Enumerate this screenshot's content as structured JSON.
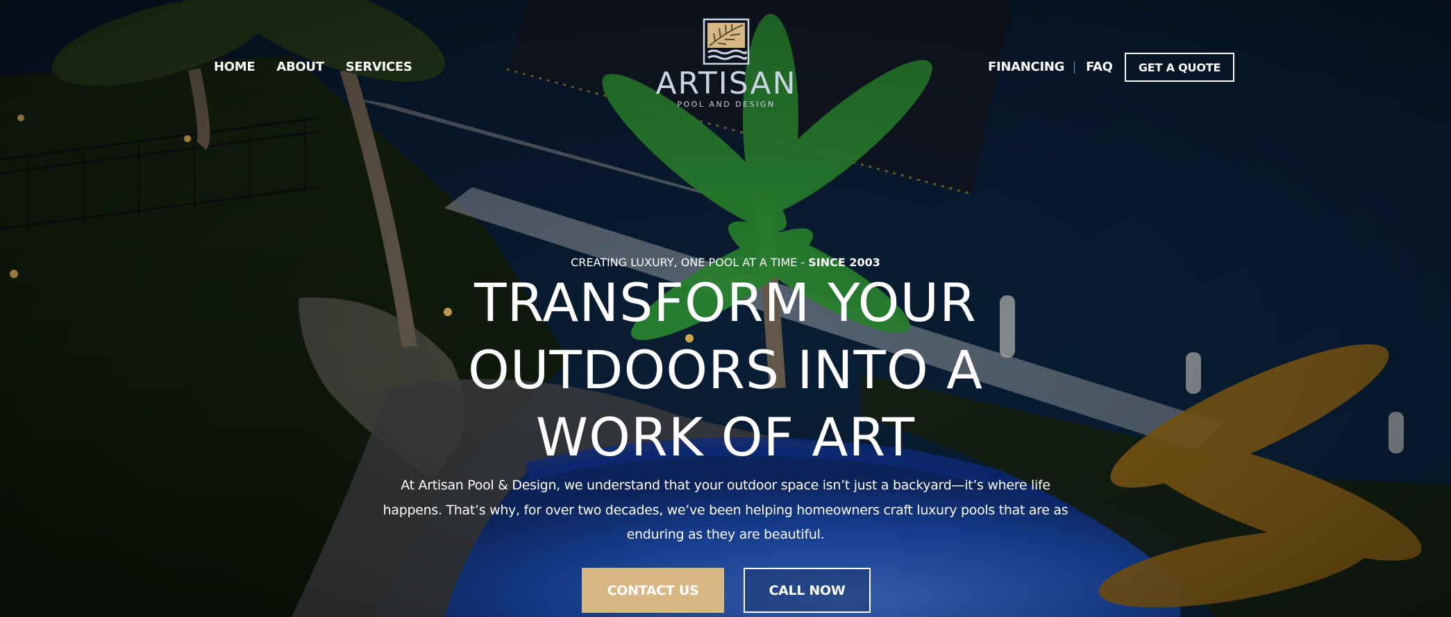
{
  "colors": {
    "accent_gold": "#d7b783",
    "text": "#ffffff",
    "logo_text": "#c9d6e2",
    "pool_blue": "#1f56c9"
  },
  "nav": {
    "left": [
      "HOME",
      "ABOUT",
      "SERVICES"
    ],
    "right": [
      "FINANCING",
      "FAQ"
    ],
    "cta": "GET A QUOTE"
  },
  "logo": {
    "name": "ARTISAN",
    "subtitle": "POOL AND DESIGN",
    "icon": "leaf-and-waves-icon"
  },
  "hero": {
    "tagline": "CREATING LUXURY, ONE POOL AT A TIME - ",
    "tagline_bold": "SINCE 2003",
    "headline": [
      "TRANSFORM YOUR",
      "OUTDOORS INTO A",
      "WORK OF ART"
    ],
    "intro": [
      "At Artisan Pool & Design, we understand that your outdoor space isn’t just a backyard—it’s where life",
      "happens. That’s why, for over two decades, we’ve been helping homeowners craft luxury pools that are as",
      "enduring as they are beautiful."
    ],
    "buttons": {
      "contact": "CONTACT US",
      "call": "CALL NOW"
    }
  }
}
